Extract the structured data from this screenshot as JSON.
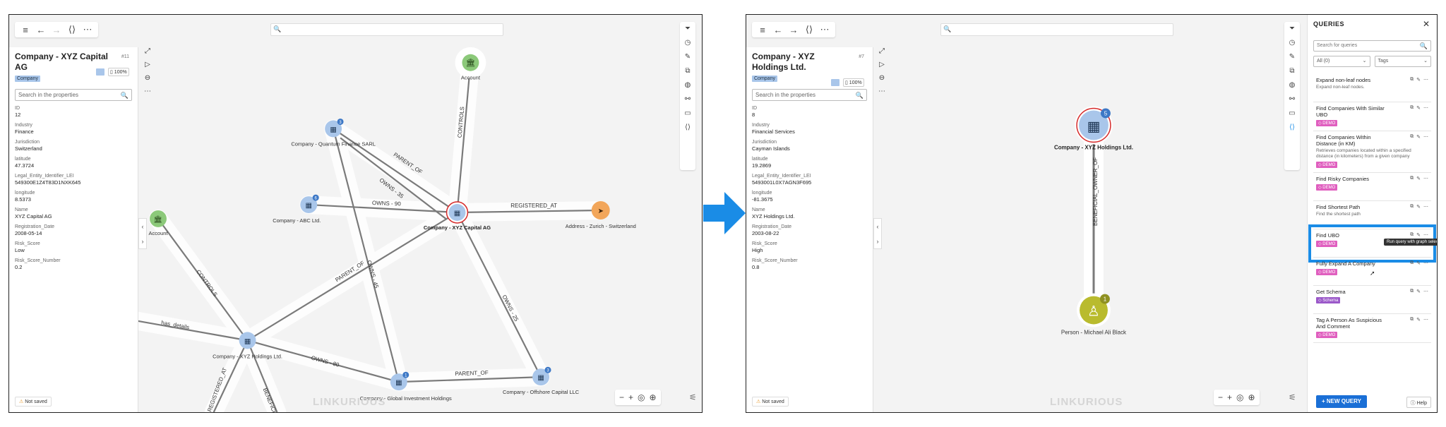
{
  "arrow_color": "#1a8ce6",
  "accent_color": "#1a6fd6",
  "left": {
    "title": "Company - XYZ Capital AG",
    "node_id": "#11",
    "category": "Company",
    "zoom": "100%",
    "search_placeholder": "Search in the properties",
    "properties": [
      {
        "label": "ID",
        "value": "12"
      },
      {
        "label": "Industry",
        "value": "Finance"
      },
      {
        "label": "Jurisdiction",
        "value": "Switzerland"
      },
      {
        "label": "latitude",
        "value": "47.3724"
      },
      {
        "label": "Legal_Entity_Identifier_LEI",
        "value": "549300E1Z4T83D1NXK645"
      },
      {
        "label": "longitude",
        "value": "8.5373"
      },
      {
        "label": "Name",
        "value": "XYZ Capital AG"
      },
      {
        "label": "Registration_Date",
        "value": "2008-05-14"
      },
      {
        "label": "Risk_Score",
        "value": "Low"
      },
      {
        "label": "Risk_Score_Number",
        "value": "0.2"
      }
    ],
    "graph": {
      "nodes": [
        {
          "label": "Account",
          "icon": "bank-icon",
          "color": "#8cc97a"
        },
        {
          "label": "Company - Quantum Finance SARL",
          "badge": "3",
          "icon": "building-icon",
          "color": "#a9c6ea"
        },
        {
          "label": "Company - ABC Ltd.",
          "badge": "6",
          "icon": "building-icon",
          "color": "#a9c6ea"
        },
        {
          "label": "Company - XYZ Capital AG",
          "icon": "building-icon",
          "color": "#a9c6ea"
        },
        {
          "label": "Address - Zurich - Switzerland",
          "icon": "location-icon",
          "color": "#f2a65a"
        },
        {
          "label": "Account",
          "icon": "bank-icon",
          "color": "#8cc97a"
        },
        {
          "label": "Company - XYZ Holdings Ltd.",
          "icon": "building-icon",
          "color": "#a9c6ea"
        },
        {
          "label": "Company - Global Investment Holdings",
          "badge": "1",
          "icon": "building-icon",
          "color": "#a9c6ea"
        },
        {
          "label": "Company - Offshore Capital LLC",
          "badge": "3",
          "icon": "building-icon",
          "color": "#a9c6ea"
        }
      ],
      "edges": [
        "CONTROLS",
        "PARENT_OF",
        "OWNS - 35",
        "OWNS - 90",
        "REGISTERED_AT",
        "OWNS - 45",
        "CONTROLS",
        "PARENT_OF",
        "OWNS - 25",
        "has_details",
        "OWNS - 80",
        "PARENT_OF",
        "REGISTERED_AT",
        "BENEFICIAL"
      ]
    },
    "not_saved": "Not saved",
    "watermark": "LINKURIOUS"
  },
  "right": {
    "title": "Company - XYZ Holdings Ltd.",
    "node_id": "#7",
    "category": "Company",
    "zoom": "100%",
    "search_placeholder": "Search in the properties",
    "properties": [
      {
        "label": "ID",
        "value": "8"
      },
      {
        "label": "Industry",
        "value": "Financial Services"
      },
      {
        "label": "Jurisdiction",
        "value": "Cayman Islands"
      },
      {
        "label": "latitude",
        "value": "19.2869"
      },
      {
        "label": "Legal_Entity_Identifier_LEI",
        "value": "5493001L0X7AGN3F695"
      },
      {
        "label": "longitude",
        "value": "-81.3675"
      },
      {
        "label": "Name",
        "value": "XYZ Holdings Ltd."
      },
      {
        "label": "Registration_Date",
        "value": "2003-08-22"
      },
      {
        "label": "Risk_Score",
        "value": "High"
      },
      {
        "label": "Risk_Score_Number",
        "value": "0.8"
      }
    ],
    "graph": {
      "nodes": [
        {
          "label": "Company - XYZ Holdings Ltd.",
          "badge": "5",
          "icon": "building-icon",
          "color": "#a9c6ea"
        },
        {
          "label": "Person - Michael Ali Black",
          "badge": "1",
          "icon": "person-icon",
          "color": "#b9bb2e"
        }
      ],
      "edges": [
        "BENEFICIAL_OWNER_OF"
      ]
    },
    "not_saved": "Not saved",
    "watermark": "LINKURIOUS",
    "queries": {
      "header": "QUERIES",
      "search_placeholder": "Search for queries",
      "filter_all": "All (0)",
      "filter_tags": "Tags",
      "tooltip": "Run query with graph selection",
      "items": [
        {
          "name": "Expand non-leaf nodes",
          "desc": "Expand non-leaf nodes.",
          "tag": "",
          "tag_color": ""
        },
        {
          "name": "Find Companies With Similar UBO",
          "desc": "",
          "tag": "DEMO",
          "tag_color": "#e05fbf"
        },
        {
          "name": "Find Companies Within Distance (in KM)",
          "desc": "Retrieves companies located within a specified distance (in kilometers) from a given company",
          "tag": "DEMO",
          "tag_color": "#e05fbf"
        },
        {
          "name": "Find Risky Companies",
          "desc": "",
          "tag": "DEMO",
          "tag_color": "#e05fbf"
        },
        {
          "name": "Find Shortest Path",
          "desc": "Find the shortest path",
          "tag": "",
          "tag_color": ""
        },
        {
          "name": "Find UBO",
          "desc": "",
          "tag": "DEMO",
          "tag_color": "#e05fbf"
        },
        {
          "name": "Fully Expand A Company",
          "desc": "",
          "tag": "DEMO",
          "tag_color": "#e05fbf"
        },
        {
          "name": "Get Schema",
          "desc": "",
          "tag": "Schema",
          "tag_color": "#9b59c9"
        },
        {
          "name": "Tag A Person As Suspicious And Comment",
          "desc": "",
          "tag": "DEMO",
          "tag_color": "#e05fbf"
        }
      ],
      "new_query": "+ NEW QUERY",
      "help": "Help"
    }
  }
}
